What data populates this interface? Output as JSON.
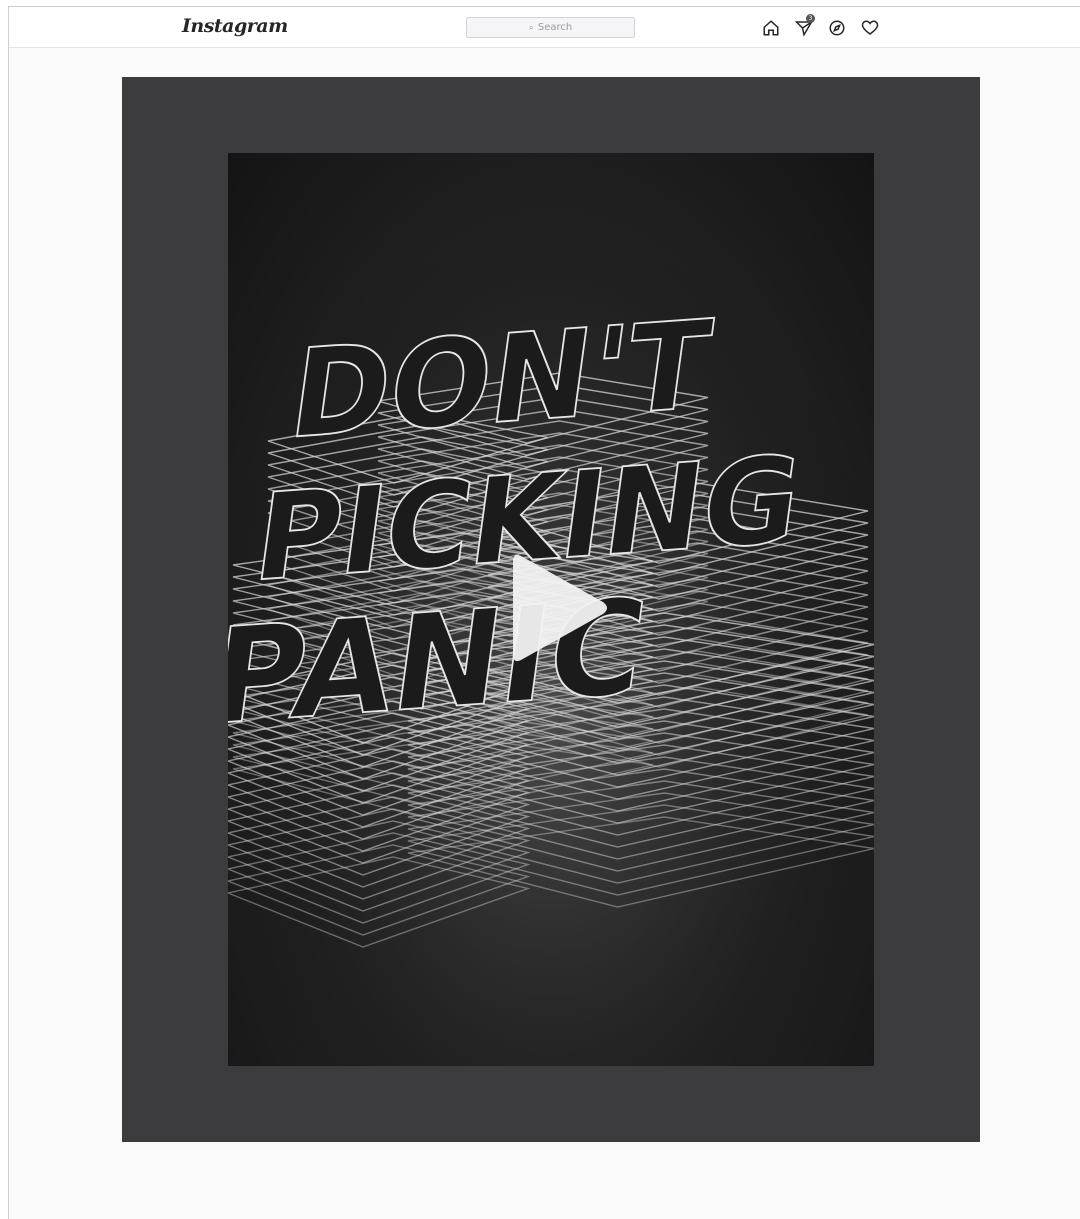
{
  "app": {
    "logo_text": "Instagram"
  },
  "search": {
    "label": "Search",
    "icon": "search-icon"
  },
  "nav": {
    "icons": [
      "home-icon",
      "direct-message-icon",
      "explore-icon",
      "activity-heart-icon"
    ],
    "direct_badge": "3"
  },
  "post": {
    "artwork_text": [
      "DON'T",
      "PICKING",
      "PANIC"
    ],
    "play_icon": "play-icon"
  },
  "colors": {
    "frame": "#3c3c3e",
    "topbar": "#ffffff",
    "page_bg": "#fafafa"
  }
}
